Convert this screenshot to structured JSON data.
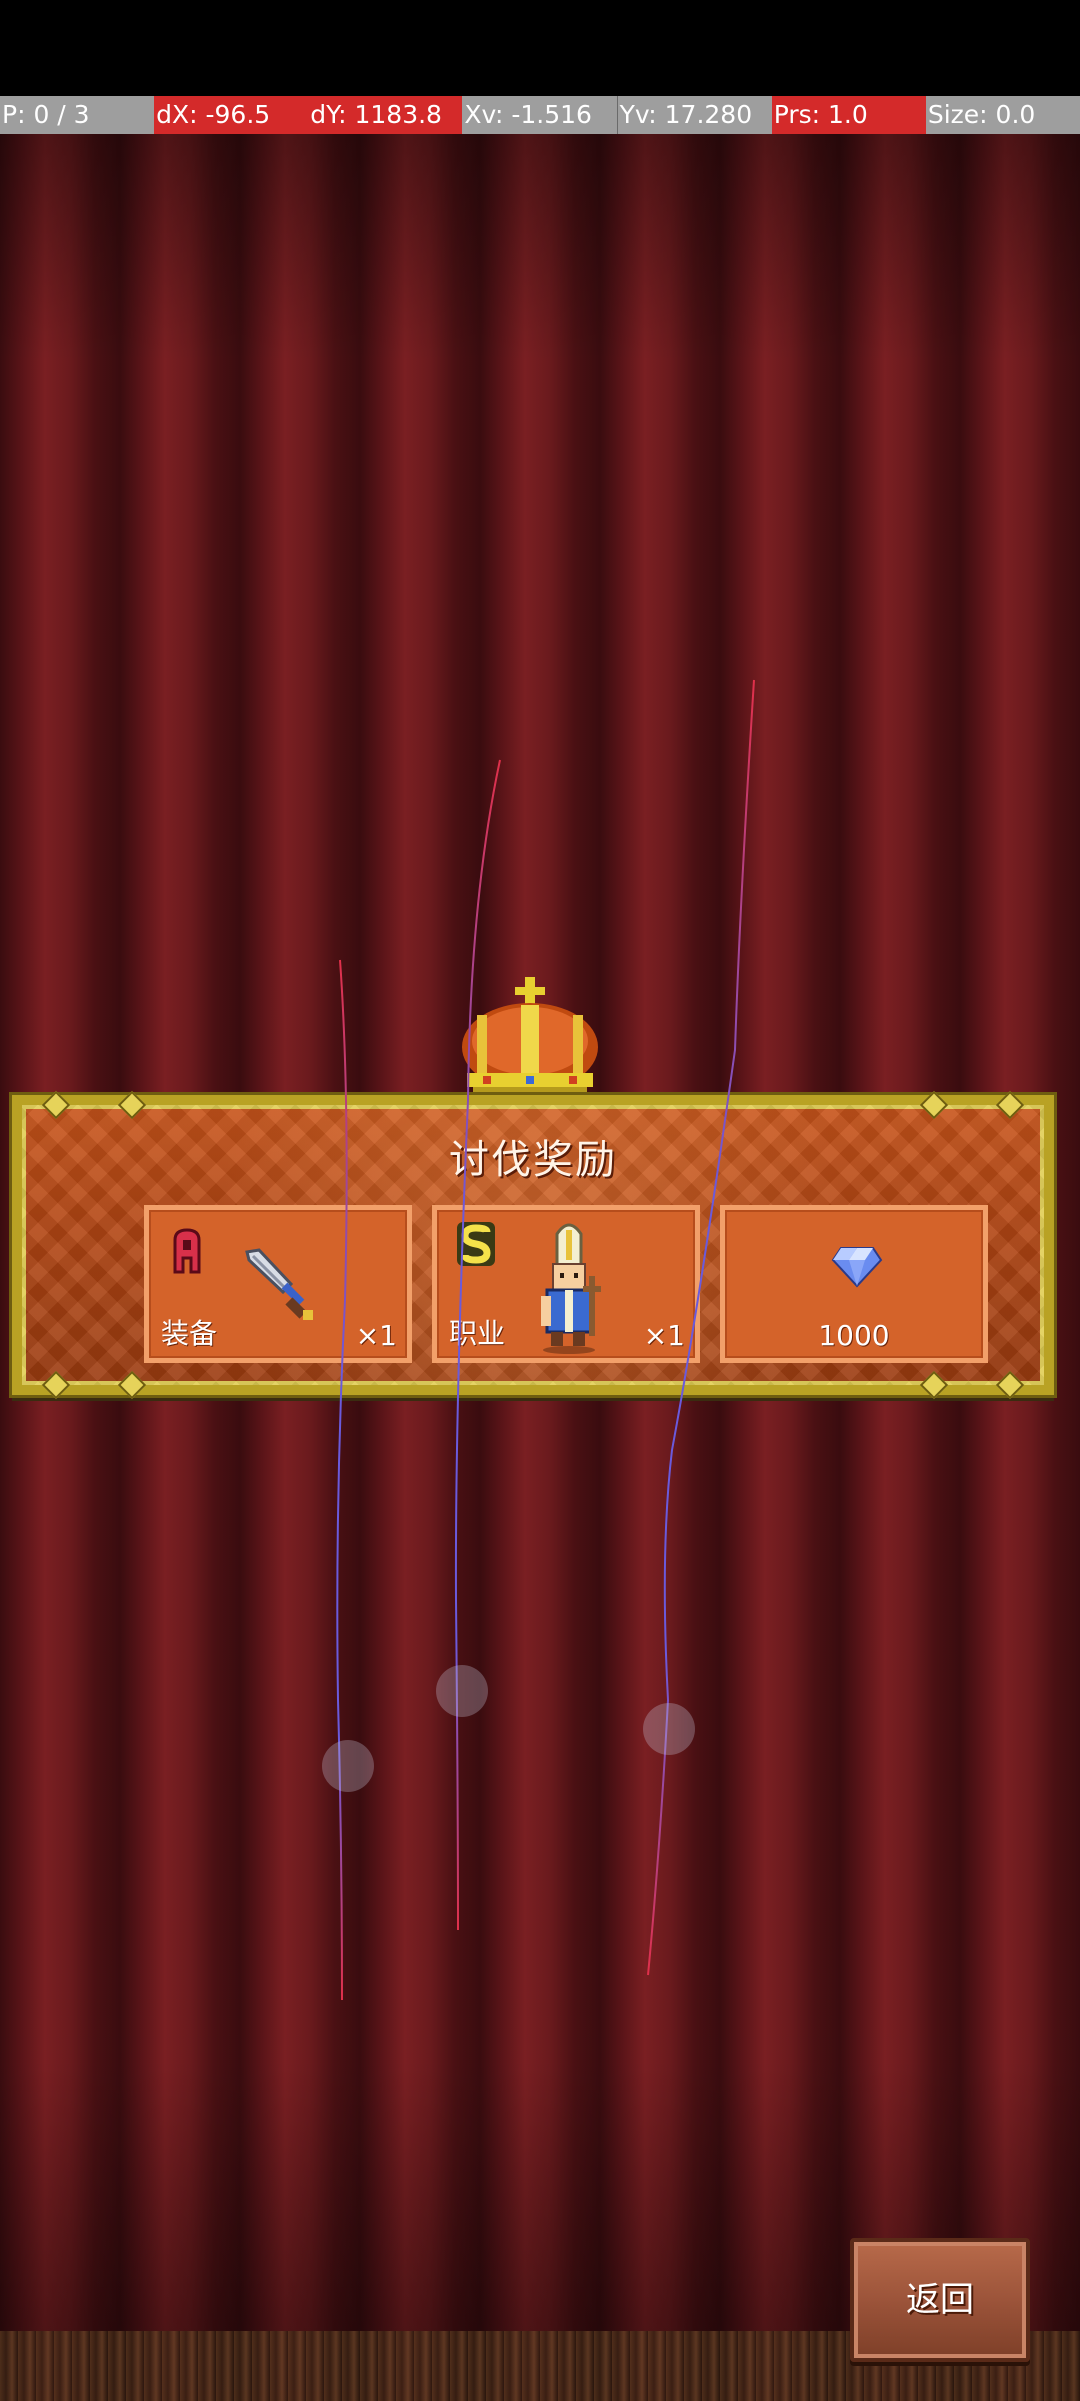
{
  "debug_bar": {
    "pointer": "P: 0 / 3",
    "dx": "dX: -96.5",
    "dy": "dY: 1183.8",
    "xv": "Xv: -1.516",
    "yv": "Yv: 17.280",
    "prs": "Prs: 1.0",
    "size": "Size: 0.0"
  },
  "banner": {
    "title": "讨伐奖励"
  },
  "rewards": [
    {
      "rank": "A",
      "label": "装备",
      "count": "×1",
      "icon": "sword-icon"
    },
    {
      "rank": "S",
      "label": "职业",
      "count": "×1",
      "icon": "priest-character-icon"
    },
    {
      "amount": "1000",
      "icon": "diamond-gem-icon"
    }
  ],
  "back_button": {
    "label": "返回"
  },
  "colors": {
    "banner_frame": "#b9a224",
    "banner_fill": "#b44714",
    "reward_border": "#f2a06a",
    "debug_red": "#d42a2a",
    "curtain": "#5a1418"
  }
}
